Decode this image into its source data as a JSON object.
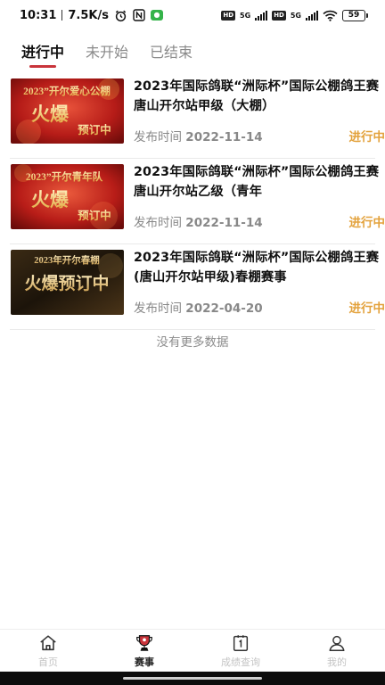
{
  "status_bar": {
    "time": "10:31",
    "speed": "7.5K/s",
    "signal1_hd": "HD",
    "signal1_gen": "5G",
    "signal2_hd": "HD",
    "signal2_gen": "5G",
    "battery": "59",
    "icons": [
      "alarm-icon",
      "nfc-icon",
      "wechat-icon",
      "wifi-icon"
    ]
  },
  "tabs": [
    {
      "label": "进行中",
      "active": true
    },
    {
      "label": "未开始",
      "active": false
    },
    {
      "label": "已结束",
      "active": false
    }
  ],
  "events": [
    {
      "title": "2023年国际鸽联“洲际杯”国际公棚鸽王赛 唐山开尔站甲级（大棚）",
      "date_label": "发布时间",
      "date": "2022-11-14",
      "status": "进行中",
      "poster_line1": "2023”开尔爱心公棚",
      "poster_line2": "火爆",
      "poster_line3": "预订中"
    },
    {
      "title": "2023年国际鸽联“洲际杯”国际公棚鸽王赛 唐山开尔站乙级（青年",
      "date_label": "发布时间",
      "date": "2022-11-14",
      "status": "进行中",
      "poster_line1": "2023”开尔青年队",
      "poster_line2": "火爆",
      "poster_line3": "预订中"
    },
    {
      "title": " 2023年国际鸽联“洲际杯”国际公棚鸽王赛(唐山开尔站甲级)春棚赛事",
      "date_label": "发布时间",
      "date": "2022-04-20",
      "status": "进行中",
      "poster_line1": "2023年开尔春棚",
      "poster_line2": "火爆预订中",
      "poster_line3": ""
    }
  ],
  "no_more": "没有更多数据",
  "bottom_nav": [
    {
      "label": "首页",
      "icon": "home-icon",
      "active": false
    },
    {
      "label": "赛事",
      "icon": "trophy-icon",
      "active": true
    },
    {
      "label": "成绩查询",
      "icon": "calendar-1-icon",
      "active": false
    },
    {
      "label": "我的",
      "icon": "user-icon",
      "active": false
    }
  ],
  "colors": {
    "accent": "#c9343b",
    "status": "#e3a23c",
    "poster_red": "#c0261e",
    "poster_gold": "#f3c86a"
  }
}
